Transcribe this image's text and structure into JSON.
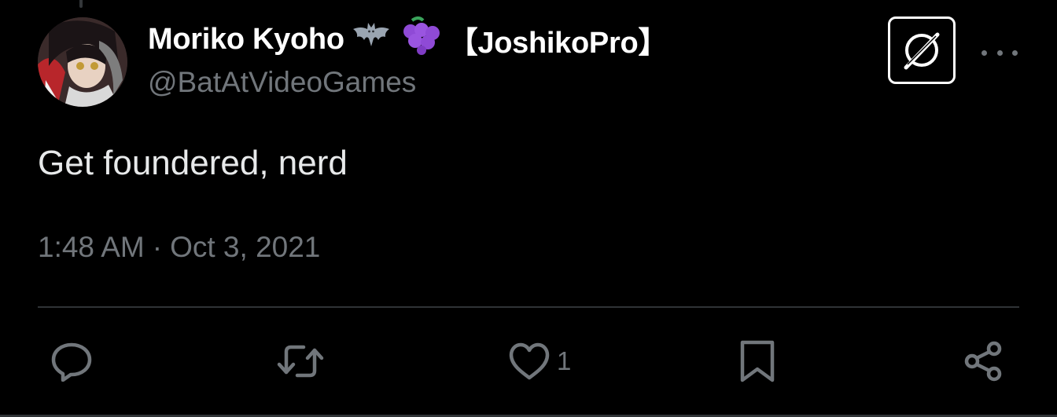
{
  "tweet": {
    "author": {
      "display_name": "Moriko Kyoho",
      "name_emojis": [
        "bat-emoji-icon",
        "grapes-emoji-icon"
      ],
      "name_suffix": "【JoshikoPro】",
      "handle": "@BatAtVideoGames",
      "avatar": "avatar"
    },
    "text": "Get foundered, nerd",
    "time": "1:48 AM",
    "separator": "·",
    "date": "Oct 3, 2021"
  },
  "header_actions": {
    "badge_icon": "grok-icon",
    "more_icon": "more-icon"
  },
  "actions": {
    "reply": {
      "icon": "reply-icon",
      "count": ""
    },
    "retweet": {
      "icon": "retweet-icon",
      "count": ""
    },
    "like": {
      "icon": "heart-icon",
      "count": "1"
    },
    "bookmark": {
      "icon": "bookmark-icon",
      "count": ""
    },
    "share": {
      "icon": "share-icon",
      "count": ""
    }
  },
  "colors": {
    "background": "#000000",
    "primary_text": "#e7e9ea",
    "secondary_text": "#71767b",
    "divider": "#2f3336"
  }
}
